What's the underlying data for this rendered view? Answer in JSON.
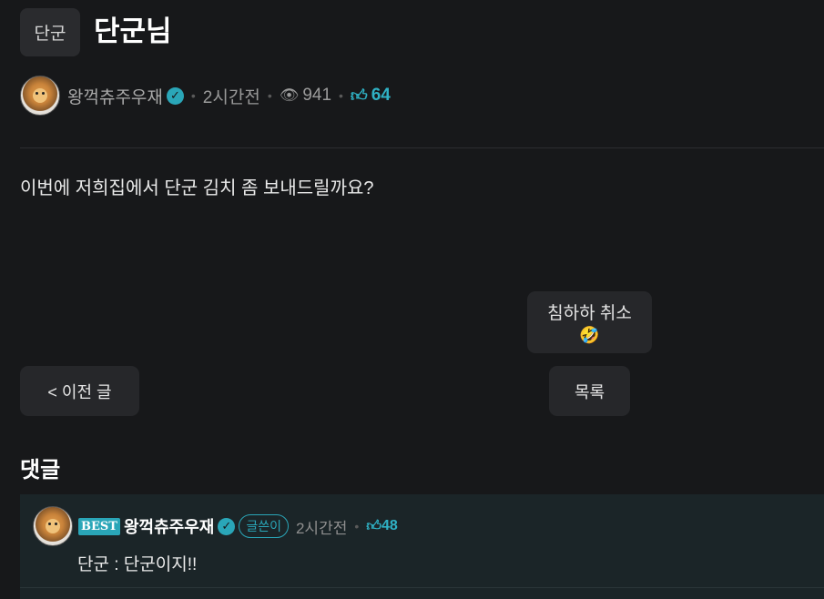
{
  "post": {
    "category": "단군",
    "title": "단군님",
    "author": "왕꺽츄주우재",
    "time": "2시간전",
    "views": "941",
    "likes": "64",
    "body": "이번에 저희집에서 단군 김치 좀 보내드릴까요?"
  },
  "actions": {
    "reaction_label": "침하하 취소",
    "reaction_emoji": "🤣",
    "prev_label": "< 이전 글",
    "list_label": "목록"
  },
  "comments": {
    "heading": "댓글",
    "items": [
      {
        "best_badge": "BEST",
        "author": "왕꺽츄주우재",
        "op_badge": "글쓴이",
        "time": "2시간전",
        "likes": "48",
        "text": "단군 : 단군이지!!"
      }
    ]
  },
  "icons": {
    "verified": "verified-check-icon",
    "views": "eye-icon",
    "likes": "thumbs-up-icon"
  },
  "colors": {
    "background": "#17181a",
    "accent": "#2fb1c4",
    "button": "#26272a",
    "comment_bg": "#1b2528"
  }
}
